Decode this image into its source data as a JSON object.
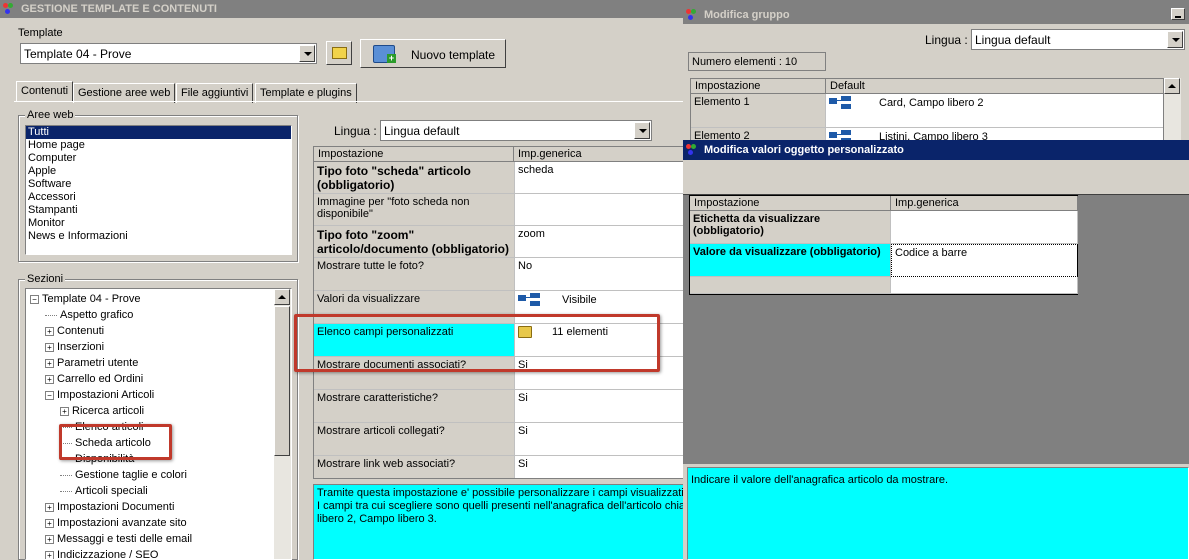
{
  "main_window": {
    "title": "GESTIONE TEMPLATE E CONTENUTI",
    "template_label": "Template",
    "template_value": "Template 04 - Prove",
    "new_template_button": "Nuovo template",
    "tabs": [
      "Contenuti",
      "Gestione aree web",
      "File aggiuntivi",
      "Template e plugins"
    ],
    "aree_web_label": "Aree web",
    "aree_web": [
      "Tutti",
      "Home page",
      "Computer",
      "Apple",
      "Software",
      "Accessori",
      "Stampanti",
      "Monitor",
      "News e Informazioni"
    ],
    "sezioni_label": "Sezioni",
    "tree": [
      {
        "label": "Template 04 - Prove",
        "box": "−"
      },
      {
        "label": "Aspetto grafico",
        "box": ""
      },
      {
        "label": "Contenuti",
        "box": "+"
      },
      {
        "label": "Inserzioni",
        "box": "+"
      },
      {
        "label": "Parametri utente",
        "box": "+"
      },
      {
        "label": "Carrello ed Ordini",
        "box": "+"
      },
      {
        "label": "Impostazioni Articoli",
        "box": "−"
      },
      {
        "label": "Ricerca articoli",
        "box": "+"
      },
      {
        "label": "Elenco articoli",
        "box": ""
      },
      {
        "label": "Scheda articolo",
        "box": ""
      },
      {
        "label": "Disponibilità",
        "box": ""
      },
      {
        "label": "Gestione taglie e colori",
        "box": ""
      },
      {
        "label": "Articoli speciali",
        "box": ""
      },
      {
        "label": "Impostazioni Documenti",
        "box": "+"
      },
      {
        "label": "Impostazioni avanzate sito",
        "box": "+"
      },
      {
        "label": "Messaggi e testi delle email",
        "box": "+"
      },
      {
        "label": "Indicizzazione / SEO",
        "box": "+"
      }
    ],
    "lingua_label": "Lingua :",
    "lingua_value": "Lingua default",
    "grid_headers": [
      "Impostazione",
      "Imp.generica"
    ],
    "grid_rows": [
      {
        "name": "Tipo foto \"scheda\" articolo (obbligatorio)",
        "value": "scheda",
        "bold": true
      },
      {
        "name": "Immagine per \"foto scheda non disponibile\"",
        "value": "",
        "bold": false
      },
      {
        "name": "Tipo foto \"zoom\" articolo/documento (obbligatorio)",
        "value": "zoom",
        "bold": true
      },
      {
        "name": "Mostrare tutte le foto?",
        "value": "No",
        "bold": false
      },
      {
        "name": "Valori da visualizzare",
        "value": "Visibile",
        "bold": false
      },
      {
        "name": "Elenco campi personalizzati",
        "value": "11 elementi",
        "bold": false
      },
      {
        "name": "Mostrare documenti associati?",
        "value": "Si",
        "bold": false
      },
      {
        "name": "Mostrare caratteristiche?",
        "value": "Si",
        "bold": false
      },
      {
        "name": "Mostrare articoli collegati?",
        "value": "Si",
        "bold": false
      },
      {
        "name": "Mostrare link web associati?",
        "value": "Si",
        "bold": false
      }
    ],
    "description": "Tramite questa impostazione e' possibile personalizzare i campi visualizzati n I campi tra cui scegliere sono quelli presenti nell'anagrafica dell'articolo chiam libero 2, Campo libero 3."
  },
  "group_window": {
    "title": "Modifica gruppo",
    "lingua_label": "Lingua :",
    "lingua_value": "Lingua default",
    "count_label": "Numero elementi : 10",
    "headers": [
      "Impostazione",
      "Default"
    ],
    "rows": [
      {
        "name": "Elemento 1",
        "value": "Card, Campo libero 2"
      },
      {
        "name": "Elemento 2",
        "value": "Listini, Campo libero 3"
      }
    ]
  },
  "custom_window": {
    "title": "Modifica valori oggetto personalizzato",
    "headers": [
      "Impostazione",
      "Imp.generica"
    ],
    "rows": [
      {
        "name": "Etichetta da visualizzare (obbligatorio)",
        "value": ""
      },
      {
        "name": "Valore da visualizzare (obbligatorio)",
        "value": "Codice a barre"
      }
    ],
    "description": "Indicare il valore dell'anagrafica articolo da mostrare."
  },
  "colors": {
    "highlight": "#00ffff",
    "annotation": "#c0392b",
    "active_title": "#0a246a",
    "selection": "#0a246a"
  }
}
